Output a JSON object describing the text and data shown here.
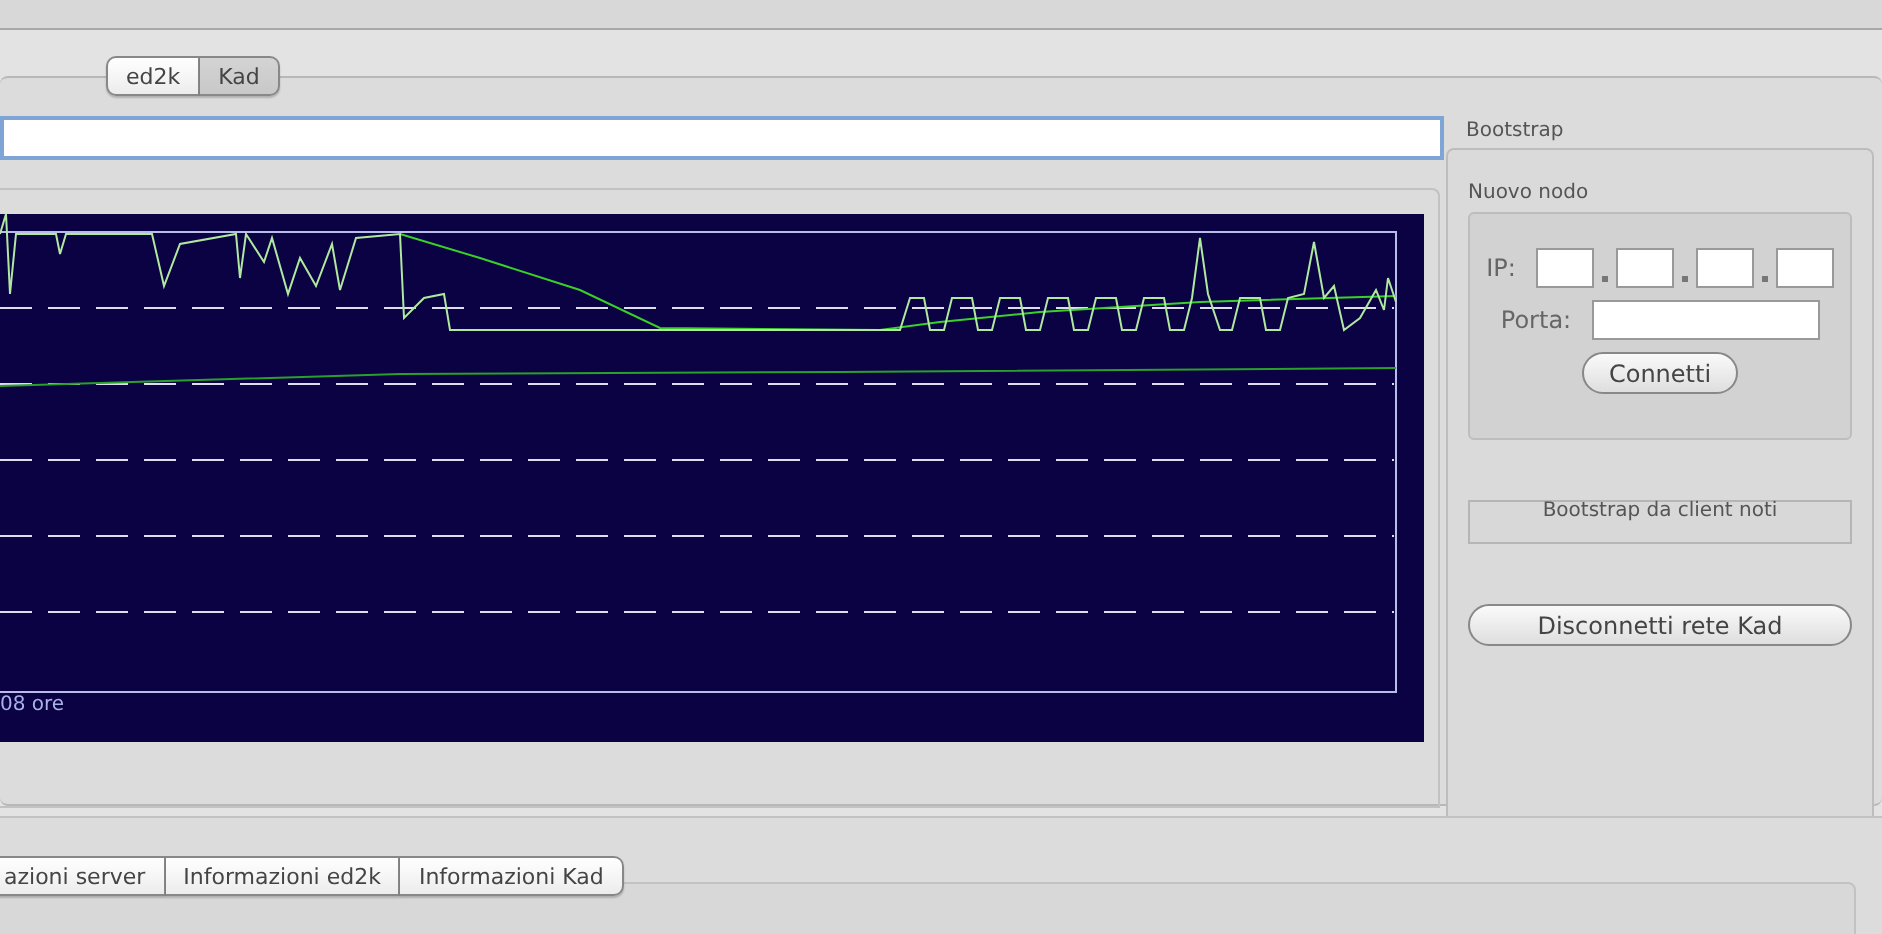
{
  "network_tabs": [
    {
      "label": "ed2k",
      "selected": false
    },
    {
      "label": "Kad",
      "selected": true
    }
  ],
  "graph": {
    "time_label": "08 ore"
  },
  "bootstrap": {
    "title": "Bootstrap",
    "new_node": {
      "title": "Nuovo nodo",
      "ip_label": "IP:",
      "port_label": "Porta:",
      "connect_button": "Connetti"
    },
    "known_clients_button": "Bootstrap da client noti",
    "disconnect_button": "Disconnetti rete Kad"
  },
  "info_tabs": [
    {
      "label": "azioni server",
      "selected": false
    },
    {
      "label": "Informazioni ed2k",
      "selected": false
    },
    {
      "label": "Informazioni Kad",
      "selected": false
    }
  ]
}
